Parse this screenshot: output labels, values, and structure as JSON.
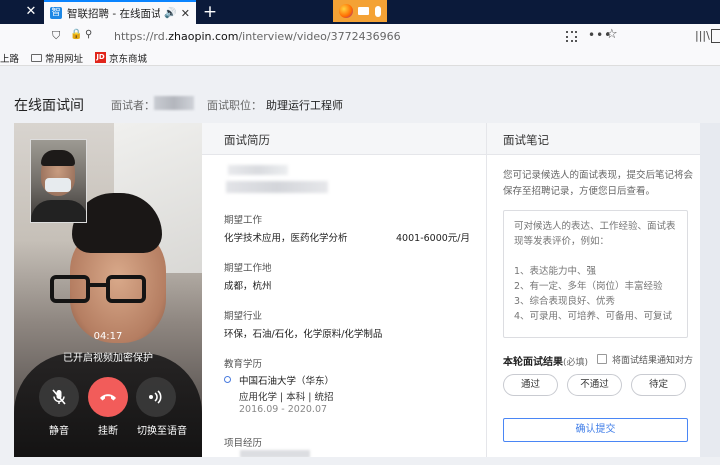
{
  "browser": {
    "tab_title": "智联招聘 - 在线面试间",
    "tab_favicon": "智",
    "url": "https://rd.zhaopin.com/interview/video/3772436966",
    "url_prefix": "https://rd.",
    "url_domain": "zhaopin.com",
    "url_path": "/interview/video/3772436966",
    "bookmarks": [
      "上路",
      "常用网址",
      "京东商城"
    ],
    "jd_icon": "JD"
  },
  "header": {
    "title": "在线面试间",
    "interviewer_label": "面试者：",
    "position_label": "面试职位：",
    "position_value": "助理运行工程师"
  },
  "video": {
    "timer": "04:17",
    "secure_text": "已开启视频加密保护",
    "mute_label": "静音",
    "hangup_label": "挂断",
    "voice_label": "切换至语音"
  },
  "resume": {
    "title": "面试简历",
    "expected_job_label": "期望工作",
    "expected_job_value": "化学技术应用，医药化学分析",
    "expected_salary": "4001-6000元/月",
    "expected_location_label": "期望工作地",
    "expected_location_value": "成都，杭州",
    "expected_industry_label": "期望行业",
    "expected_industry_value": "环保，石油/石化，化学原料/化学制品",
    "education_label": "教育学历",
    "education": {
      "school": "中国石油大学（华东）",
      "major": "应用化学 | 本科 | 统招",
      "dates": "2016.09 - 2020.07"
    },
    "project_label": "项目经历"
  },
  "notes": {
    "title": "面试笔记",
    "description": "您可记录候选人的面试表现，提交后笔记将会保存至招聘记录，方便您日后查看。",
    "placeholder": "可对候选人的表达、工作经验、面试表现等发表评价，例如：\n\n1、表达能力中、强\n2、有一定、多年（岗位）丰富经验\n3、综合表现良好、优秀\n4、可录用、可培养、可备用、可复试",
    "result_label": "本轮面试结果",
    "result_required": "(必填)",
    "notify_label": "将面试结果通知对方",
    "btn_pass": "通过",
    "btn_fail": "不通过",
    "btn_pending": "待定",
    "submit": "确认提交"
  },
  "colors": {
    "accent": "#4a86f5",
    "hangup": "#f25c5a",
    "tabbar": "#0b1a3a",
    "share_indicator": "#f4a235"
  }
}
